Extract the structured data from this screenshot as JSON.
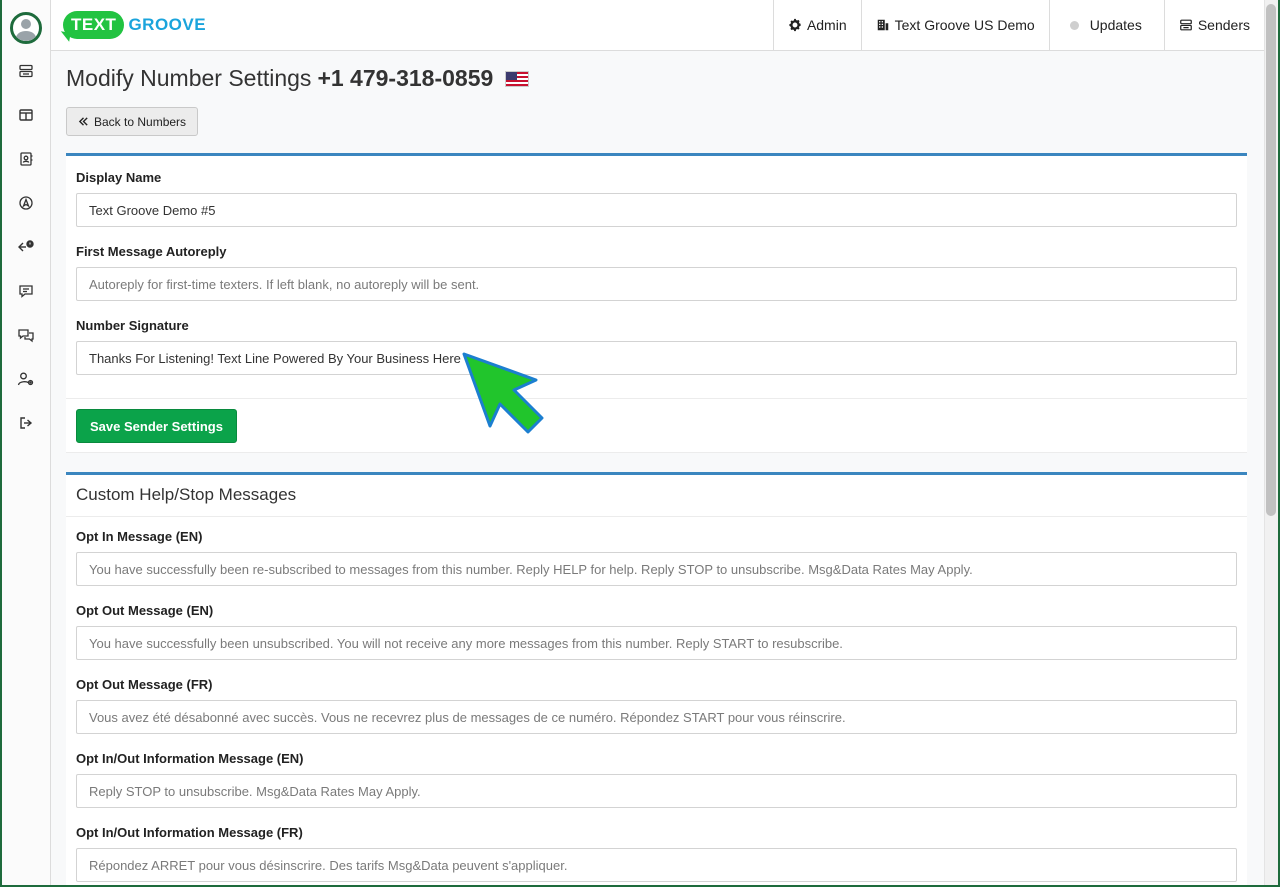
{
  "app": {
    "logo_text": "TEXT",
    "logo_brand": "GROOVE"
  },
  "header": {
    "nav": [
      {
        "label": "Admin",
        "icon": "gear-icon"
      },
      {
        "label": "Text Groove US Demo",
        "icon": "building-icon"
      },
      {
        "label": "Updates",
        "icon": "status-dot-icon"
      },
      {
        "label": "Senders",
        "icon": "server-stack-icon"
      }
    ]
  },
  "sidebar": {
    "items": [
      {
        "name": "inbox-icon"
      },
      {
        "name": "layout-icon"
      },
      {
        "name": "contacts-icon"
      },
      {
        "name": "compass-icon"
      },
      {
        "name": "reply-notification-icon"
      },
      {
        "name": "message-icon"
      },
      {
        "name": "chat-bubbles-icon"
      },
      {
        "name": "user-settings-icon"
      },
      {
        "name": "logout-icon"
      }
    ]
  },
  "page": {
    "title": "Modify Number Settings",
    "number": "+1 479-318-0859",
    "back_label": "Back to Numbers"
  },
  "sender_settings": {
    "display_name_label": "Display Name",
    "display_name_value": "Text Groove Demo #5",
    "autoreply_label": "First Message Autoreply",
    "autoreply_placeholder": "Autoreply for first-time texters. If left blank, no autoreply will be sent.",
    "signature_label": "Number Signature",
    "signature_value": "Thanks For Listening! Text Line Powered By Your Business Here",
    "save_label": "Save Sender Settings"
  },
  "help_stop": {
    "title": "Custom Help/Stop Messages",
    "fields": [
      {
        "label": "Opt In Message (EN)",
        "placeholder": "You have successfully been re-subscribed to messages from this number. Reply HELP for help. Reply STOP to unsubscribe. Msg&Data Rates May Apply."
      },
      {
        "label": "Opt Out Message (EN)",
        "placeholder": "You have successfully been unsubscribed. You will not receive any more messages from this number. Reply START to resubscribe."
      },
      {
        "label": "Opt Out Message (FR)",
        "placeholder": "Vous avez été désabonné avec succès. Vous ne recevrez plus de messages de ce numéro. Répondez START pour vous réinscrire."
      },
      {
        "label": "Opt In/Out Information Message (EN)",
        "placeholder": "Reply STOP to unsubscribe. Msg&Data Rates May Apply."
      },
      {
        "label": "Opt In/Out Information Message (FR)",
        "placeholder": "Répondez ARRET pour vous désinscrire. Des tarifs Msg&Data peuvent s'appliquer."
      }
    ]
  },
  "colors": {
    "accent_green": "#0ba34a",
    "card_border_blue": "#3b86bf",
    "logo_green": "#22c341",
    "logo_blue": "#1aa4dc"
  }
}
